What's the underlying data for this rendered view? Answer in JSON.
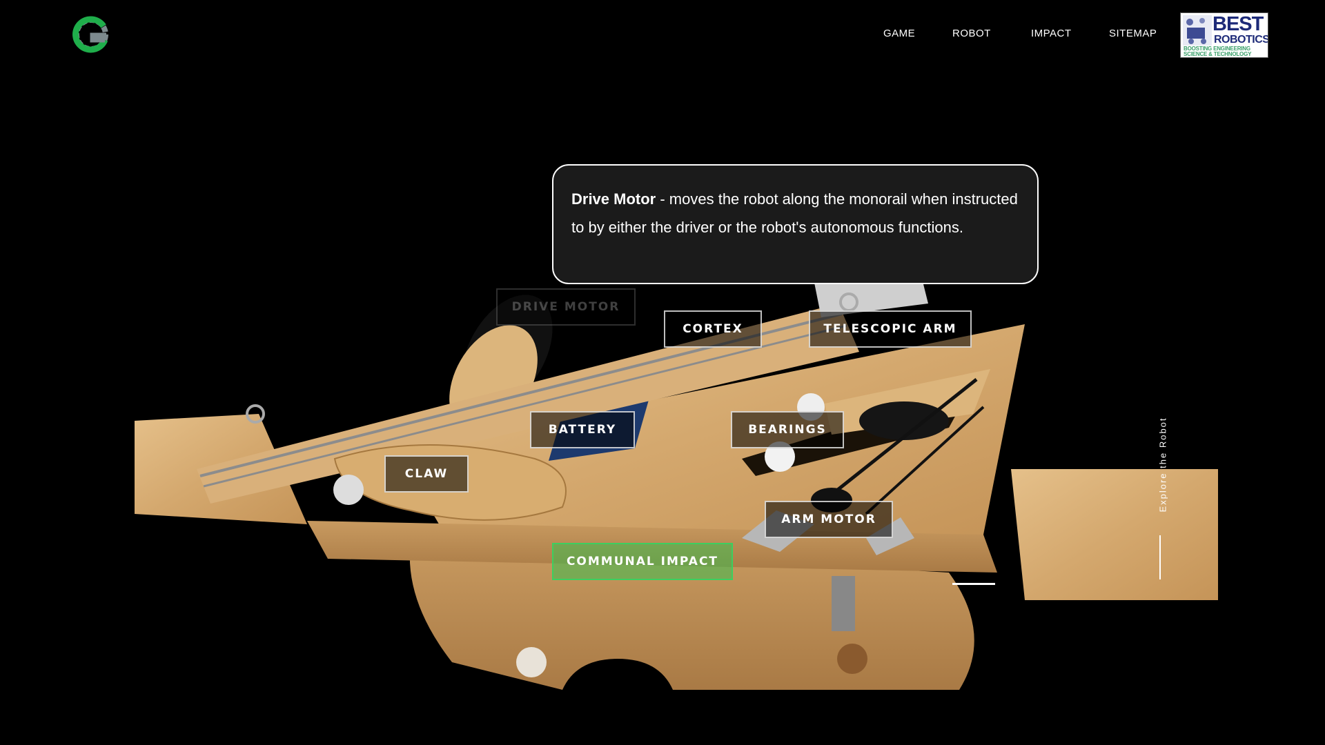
{
  "nav": {
    "items": [
      "GAME",
      "ROBOT",
      "IMPACT",
      "SITEMAP"
    ]
  },
  "best_logo": {
    "big": "BEST",
    "robotics": "ROBOTICS",
    "tagline": "BOOSTING ENGINEERING SCIENCE & TECHNOLOGY"
  },
  "tooltip": {
    "title": "Drive Motor",
    "text": " - moves the robot along the monorail when instructed to by either the driver or the robot's autonomous functions."
  },
  "hotspots": {
    "drive_motor": "DRIVE MOTOR",
    "cortex": "CORTEX",
    "telescopic_arm": "TELESCOPIC ARM",
    "battery": "BATTERY",
    "bearings": "BEARINGS",
    "claw": "CLAW",
    "arm_motor": "ARM MOTOR",
    "communal_impact": "COMMUNAL IMPACT"
  },
  "explore_label": "Explore the Robot",
  "colors": {
    "background": "#000000",
    "accent_green": "#3ccf5f",
    "logo_green": "#1fae4b",
    "logo_gray": "#7d8a8e",
    "wood": "#d8b07a",
    "best_navy": "#1d2a78"
  }
}
